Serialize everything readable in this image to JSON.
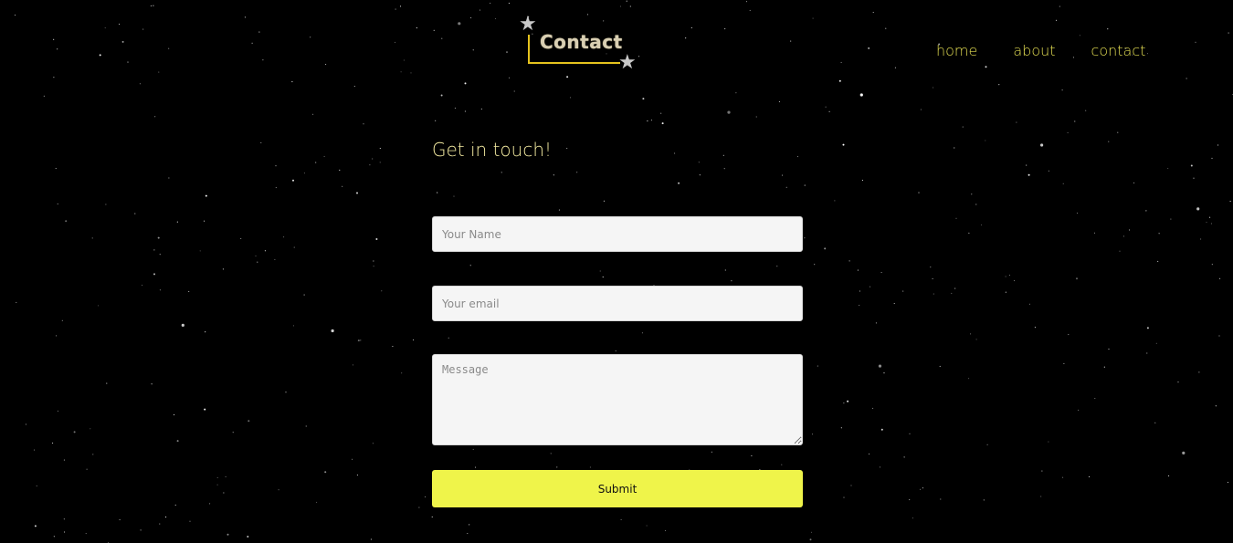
{
  "logo": {
    "text": "Contact",
    "star_glyph": "★",
    "accent_color": "#e5c31d"
  },
  "nav": {
    "items": [
      {
        "label": "home"
      },
      {
        "label": "about"
      },
      {
        "label": "contact"
      }
    ],
    "color": "#e3dd52"
  },
  "main": {
    "heading": "Get in touch!"
  },
  "form": {
    "name_placeholder": "Your Name",
    "name_value": "",
    "email_placeholder": "Your email",
    "email_value": "",
    "message_placeholder": "Message",
    "message_value": "",
    "submit_label": "Submit",
    "submit_color": "#eff44a"
  },
  "background": {
    "color": "#000000",
    "style": "starfield"
  }
}
